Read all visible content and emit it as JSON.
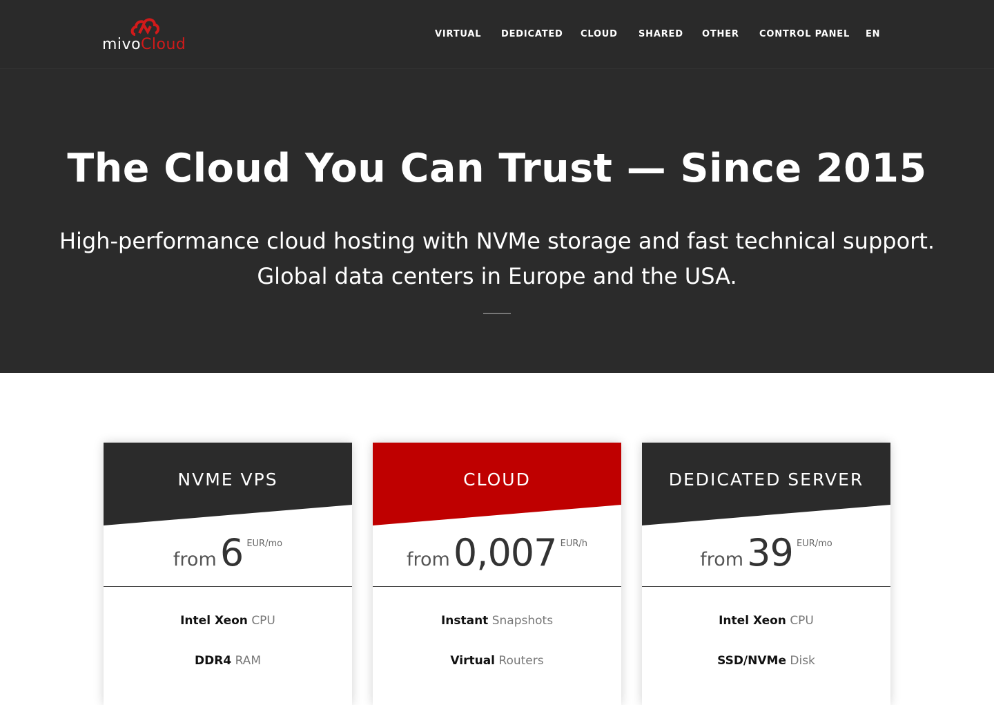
{
  "brand": {
    "name_part1": "mivo",
    "name_part2": "Cloud",
    "accent": "#d11a1a"
  },
  "nav": {
    "items": [
      "VIRTUAL",
      "DEDICATED",
      "CLOUD",
      "SHARED",
      "OTHER",
      "CONTROL PANEL",
      "EN"
    ]
  },
  "hero": {
    "title": "The Cloud You Can Trust — Since 2015",
    "subtitle_line1": "High-performance cloud hosting with NVMe storage and fast technical support.",
    "subtitle_line2": "Global data centers in Europe and the USA."
  },
  "plans": [
    {
      "title": "NVME VPS",
      "header_color": "#2b2b2b",
      "from": "from",
      "price": "6",
      "unit": "EUR/mo",
      "features": [
        {
          "bold": "Intel Xeon",
          "rest": "CPU"
        },
        {
          "bold": "DDR4",
          "rest": "RAM"
        }
      ]
    },
    {
      "title": "CLOUD",
      "header_color": "#bf0000",
      "from": "from",
      "price": "0,007",
      "unit": "EUR/h",
      "features": [
        {
          "bold": "Instant",
          "rest": "Snapshots"
        },
        {
          "bold": "Virtual",
          "rest": "Routers"
        }
      ]
    },
    {
      "title": "DEDICATED SERVER",
      "header_color": "#2b2b2b",
      "from": "from",
      "price": "39",
      "unit": "EUR/mo",
      "features": [
        {
          "bold": "Intel Xeon",
          "rest": "CPU"
        },
        {
          "bold": "SSD/NVMe",
          "rest": "Disk"
        }
      ]
    }
  ]
}
